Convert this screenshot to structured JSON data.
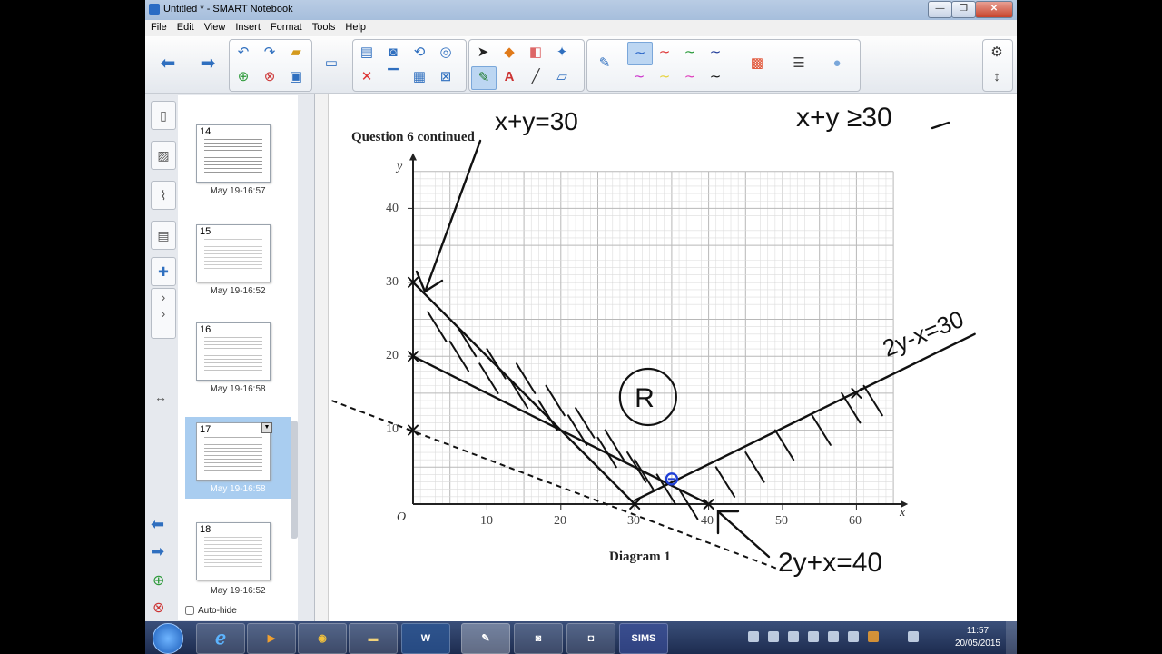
{
  "window": {
    "title": "Untitled * - SMART Notebook"
  },
  "menu": [
    "File",
    "Edit",
    "View",
    "Insert",
    "Format",
    "Tools",
    "Help"
  ],
  "sidebar": {
    "pages": [
      {
        "number": "14",
        "label": "May 19-16:57",
        "selected": false
      },
      {
        "number": "15",
        "label": "May 19-16:52",
        "selected": false
      },
      {
        "number": "16",
        "label": "May 19-16:58",
        "selected": false
      },
      {
        "number": "17",
        "label": "May 19-16:58",
        "selected": true
      },
      {
        "number": "18",
        "label": "May 19-16:52",
        "selected": false
      }
    ],
    "autohide_label": "Auto-hide"
  },
  "slide": {
    "heading": "Question 6 continued",
    "diagram_label": "Diagram 1",
    "origin_label": "O",
    "x_axis_label": "x",
    "y_axis_label": "y",
    "x_ticks": [
      "10",
      "20",
      "30",
      "40",
      "50",
      "60"
    ],
    "y_ticks": [
      "10",
      "20",
      "30",
      "40"
    ],
    "annotations": {
      "line1": "x+y=30",
      "inequality": "x+y ≥30",
      "line2": "2y-x=30",
      "line3": "2y+x=40",
      "region": "R"
    }
  },
  "taskbar": {
    "sims_label": "SIMS",
    "word_label": "W",
    "time": "11:57",
    "date": "20/05/2015"
  }
}
